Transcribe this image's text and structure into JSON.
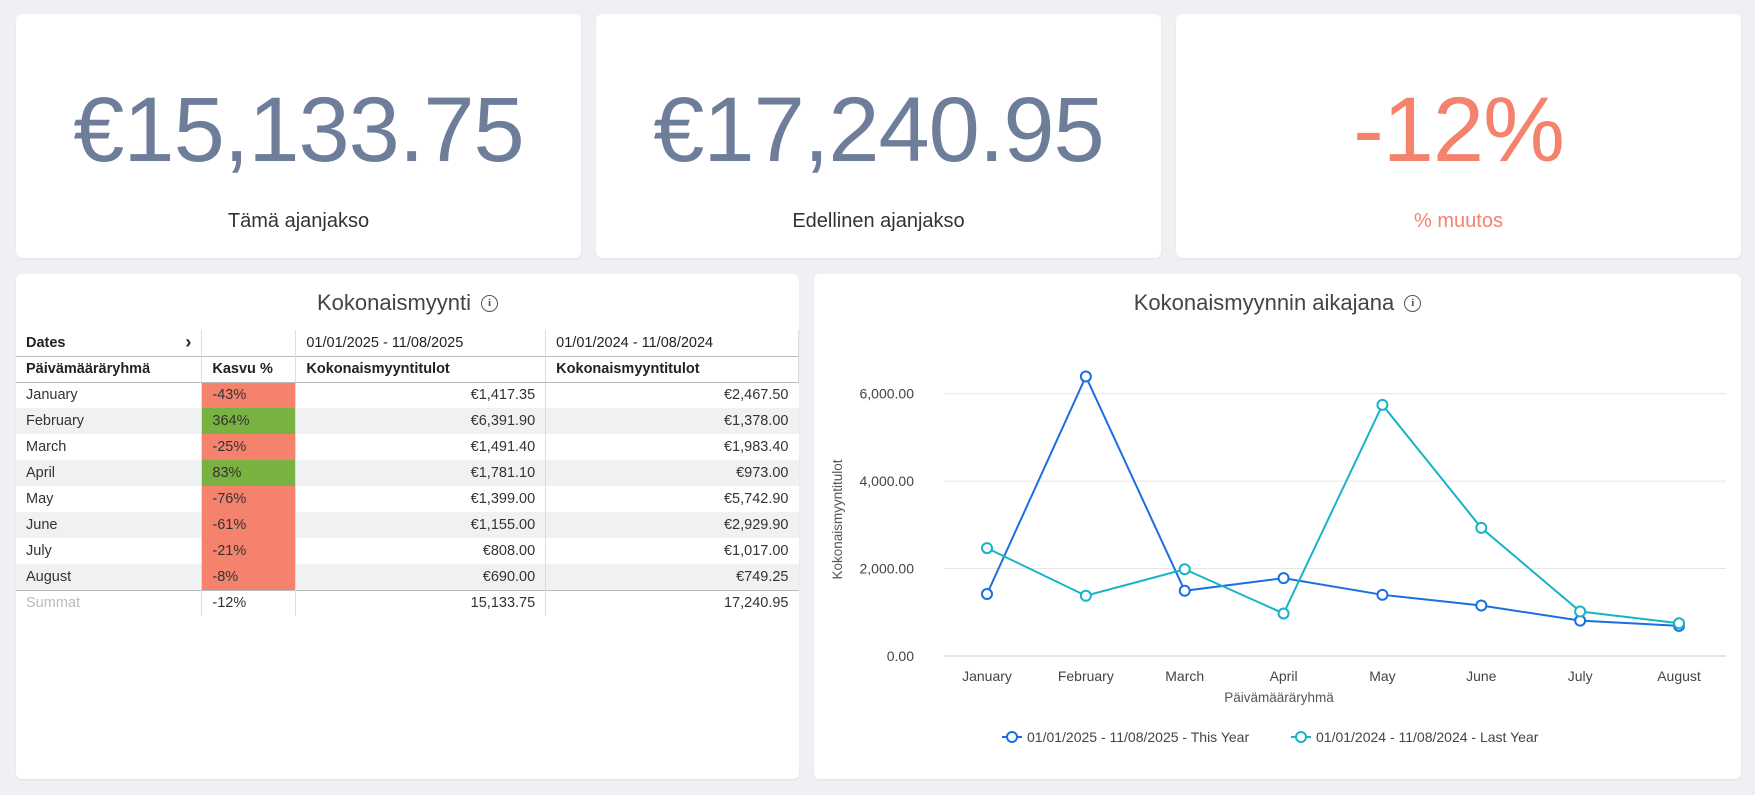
{
  "kpis": [
    {
      "value": "€15,133.75",
      "label": "Tämä ajanjakso"
    },
    {
      "value": "€17,240.95",
      "label": "Edellinen ajanjakso"
    },
    {
      "value": "-12%",
      "label": "% muutos"
    }
  ],
  "table_panel": {
    "title": "Kokonaismyynti",
    "dates_label": "Dates",
    "range_this": "01/01/2025 - 11/08/2025",
    "range_last": "01/01/2024 - 11/08/2024",
    "headers": [
      "Päivämääräryhmä",
      "Kasvu %",
      "Kokonaismyyntitulot",
      "Kokonaismyyntitulot"
    ],
    "rows": [
      {
        "month": "January",
        "growth": "-43%",
        "this": "€1,417.35",
        "last": "€2,467.50",
        "trend": "neg"
      },
      {
        "month": "February",
        "growth": "364%",
        "this": "€6,391.90",
        "last": "€1,378.00",
        "trend": "pos"
      },
      {
        "month": "March",
        "growth": "-25%",
        "this": "€1,491.40",
        "last": "€1,983.40",
        "trend": "neg"
      },
      {
        "month": "April",
        "growth": "83%",
        "this": "€1,781.10",
        "last": "€973.00",
        "trend": "pos"
      },
      {
        "month": "May",
        "growth": "-76%",
        "this": "€1,399.00",
        "last": "€5,742.90",
        "trend": "neg"
      },
      {
        "month": "June",
        "growth": "-61%",
        "this": "€1,155.00",
        "last": "€2,929.90",
        "trend": "neg"
      },
      {
        "month": "July",
        "growth": "-21%",
        "this": "€808.00",
        "last": "€1,017.00",
        "trend": "neg"
      },
      {
        "month": "August",
        "growth": "-8%",
        "this": "€690.00",
        "last": "€749.25",
        "trend": "neg"
      }
    ],
    "totals": {
      "label": "Summat",
      "growth": "-12%",
      "this": "15,133.75",
      "last": "17,240.95"
    }
  },
  "chart_panel": {
    "title": "Kokonaismyynnin aikajana"
  },
  "colors": {
    "this_year": "#1a6fe0",
    "last_year": "#17b3c7",
    "kpi_value": "#6d7d9a",
    "negative": "#f4826d",
    "positive": "#79b241"
  },
  "chart_data": {
    "type": "line",
    "title": "Kokonaismyynnin aikajana",
    "xlabel": "Päivämääräryhmä",
    "ylabel": "Kokonaismyyntitulot",
    "categories": [
      "January",
      "February",
      "March",
      "April",
      "May",
      "June",
      "July",
      "August"
    ],
    "ylim": [
      0,
      6000
    ],
    "yticks": [
      0,
      2000,
      4000,
      6000
    ],
    "ytick_labels": [
      "0.00",
      "2,000.00",
      "4,000.00",
      "6,000.00"
    ],
    "grid": true,
    "legend_position": "bottom",
    "series": [
      {
        "name": "01/01/2025 - 11/08/2025 - This Year",
        "values": [
          1417.35,
          6391.9,
          1491.4,
          1781.1,
          1399.0,
          1155.0,
          808.0,
          690.0
        ]
      },
      {
        "name": "01/01/2024 - 11/08/2024 - Last Year",
        "values": [
          2467.5,
          1378.0,
          1983.4,
          973.0,
          5742.9,
          2929.9,
          1017.0,
          749.25
        ]
      }
    ]
  }
}
